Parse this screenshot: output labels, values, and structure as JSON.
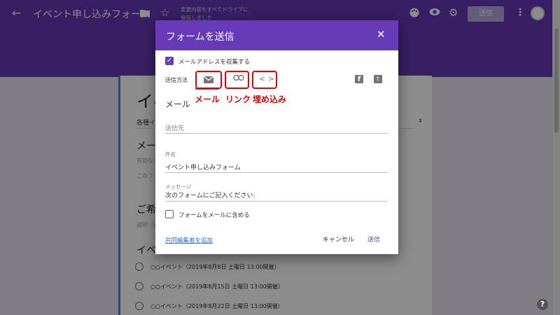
{
  "header": {
    "title": "イベント申し込みフォーム",
    "save_status": "変更内容をすべてドライブに保存しました",
    "send_label": "送信"
  },
  "background_form": {
    "title": "イベ",
    "type_label": "各種イベ",
    "question1_title": "メール",
    "question1_hint": "有効なメ",
    "question1_note": "このフォー",
    "question2_title": "ご希望",
    "question2_desc": "説明（省",
    "question3_title": "イベン",
    "options": [
      "○○イベント（2019年8月8日 土曜日 13:00開催）",
      "○○イベント（2019年8月15日 土曜日 13:00開催）",
      "○○イベント（2019年8月22日 土曜日 13:00開催）"
    ]
  },
  "dialog": {
    "title": "フォームを送信",
    "collect_email_label": "メールアドレスを収集する",
    "send_method_label": "送信方法",
    "section_title": "メール",
    "to_placeholder": "送信先",
    "subject_label": "件名",
    "subject_value": "イベント申し込みフォーム",
    "message_label": "メッセージ",
    "message_value": "次のフォームにご記入ください:",
    "include_form_label": "フォームをメールに含める",
    "add_collaborators": "共同編集者を追加",
    "cancel_label": "キャンセル",
    "send_label": "送信"
  },
  "annotations": {
    "mail": "メール",
    "link": "リンク",
    "embed": "埋め込み"
  }
}
